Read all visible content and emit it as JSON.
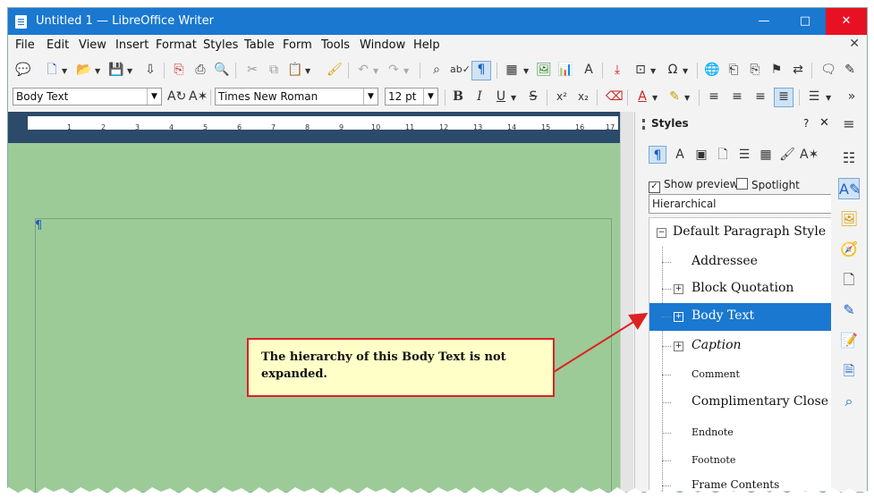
{
  "window": {
    "title": "Untitled 1 — LibreOffice Writer",
    "controls": {
      "minimize": "—",
      "maximize": "□",
      "close": "✕"
    }
  },
  "menubar": {
    "items": [
      "File",
      "Edit",
      "View",
      "Insert",
      "Format",
      "Styles",
      "Table",
      "Form",
      "Tools",
      "Window",
      "Help"
    ],
    "close": "✕"
  },
  "formatting": {
    "paragraph_style": "Body Text",
    "font_name": "Times New Roman",
    "font_size": "12 pt",
    "bold": "B",
    "italic": "I",
    "underline": "U",
    "strike": "S",
    "superscript": "x²",
    "subscript": "x₂"
  },
  "ruler": {
    "ticks": [
      "1",
      "2",
      "3",
      "4",
      "5",
      "6",
      "7",
      "8",
      "9",
      "10",
      "11",
      "12",
      "13",
      "14",
      "15",
      "16",
      "17"
    ]
  },
  "document": {
    "pilcrow": "¶"
  },
  "sidebar": {
    "title": "Styles",
    "help": "?",
    "close": "✕",
    "show_previews_label": "Show previews",
    "show_previews_checked": true,
    "spotlight_label": "Spotlight",
    "spotlight_checked": false,
    "filter_value": "Hierarchical",
    "tree": [
      {
        "label": "Default Paragraph Style",
        "expander": "−",
        "selected": false
      },
      {
        "label": "Addressee",
        "expander": "",
        "selected": false
      },
      {
        "label": "Block Quotation",
        "expander": "+",
        "selected": false
      },
      {
        "label": "Body Text",
        "expander": "+",
        "selected": true
      },
      {
        "label": "Caption",
        "expander": "+",
        "selected": false
      },
      {
        "label": "Comment",
        "expander": "",
        "selected": false
      },
      {
        "label": "Complimentary Close",
        "expander": "",
        "selected": false
      },
      {
        "label": "Endnote",
        "expander": "",
        "selected": false
      },
      {
        "label": "Footnote",
        "expander": "",
        "selected": false
      },
      {
        "label": "Frame Contents",
        "expander": "",
        "selected": false
      }
    ]
  },
  "deck": {
    "icons": [
      "properties-icon",
      "styles-icon",
      "gallery-icon",
      "navigator-icon",
      "page-icon",
      "style-inspector-icon",
      "manage-changes-icon",
      "design-icon",
      "find-icon"
    ]
  },
  "callout": {
    "text": "The hierarchy of this Body Text is not expanded."
  },
  "colors": {
    "titlebar": "#1a78d0",
    "close_button": "#e81123",
    "document_background": "#9ccb98",
    "ruler_background": "#2c4a6a",
    "selection": "#1a78d0",
    "callout_fill": "#ffffc8",
    "callout_border": "#dd2222"
  }
}
